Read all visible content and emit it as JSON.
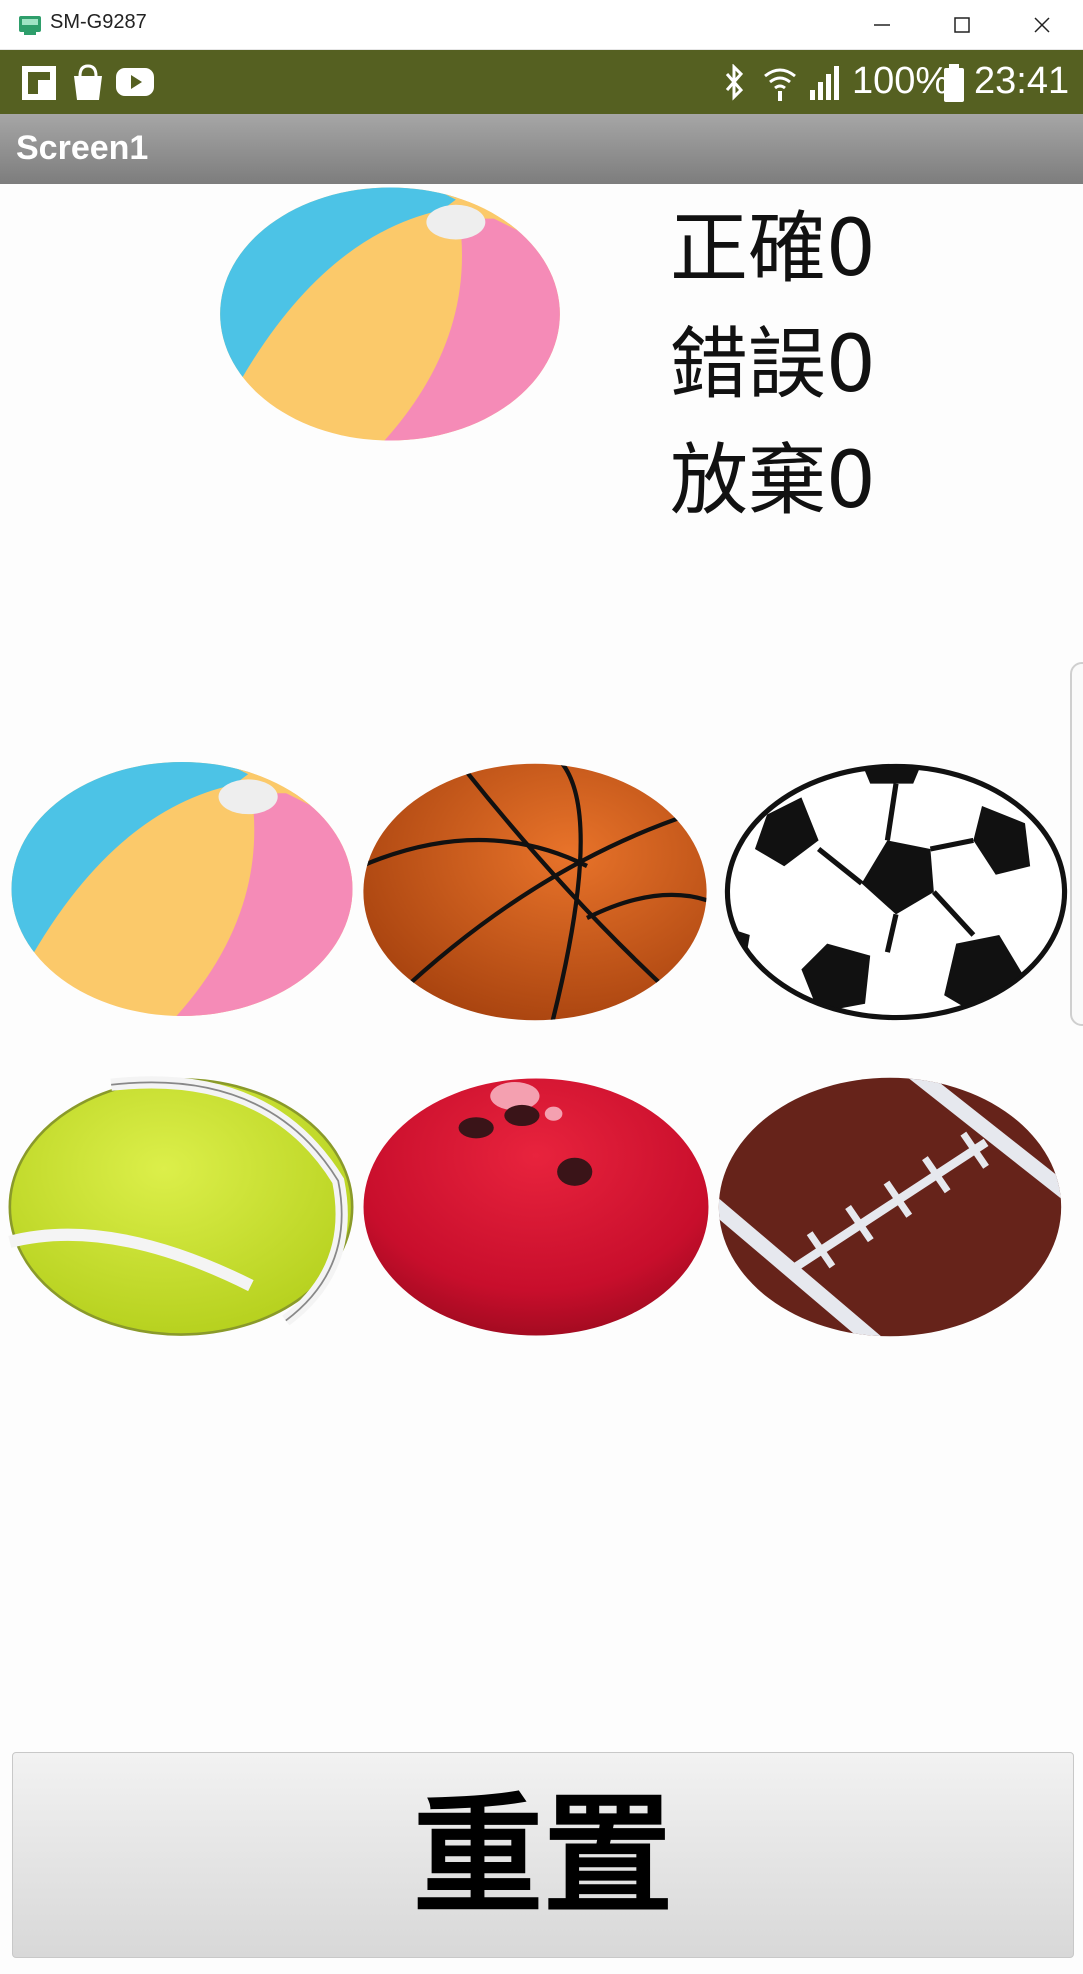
{
  "window": {
    "title": "SM-G9287"
  },
  "status_bar": {
    "battery": "100%",
    "time": "23:41",
    "left_icons": [
      "flipboard-icon",
      "shopping-bag-icon",
      "youtube-icon"
    ],
    "right_icons": [
      "bluetooth-icon",
      "wifi-icon",
      "signal-icon",
      "battery-icon"
    ],
    "background": "#556021"
  },
  "app_bar": {
    "title": "Screen1"
  },
  "target_ball": "beach-ball",
  "scores": {
    "correct_label": "正確",
    "correct_value": "0",
    "wrong_label": "錯誤",
    "wrong_value": "0",
    "giveup_label": "放棄",
    "giveup_value": "0"
  },
  "choices": [
    "beach-ball",
    "basketball",
    "soccer-ball",
    "tennis-ball",
    "bowling-ball",
    "american-football"
  ],
  "reset_button": {
    "label": "重置"
  }
}
